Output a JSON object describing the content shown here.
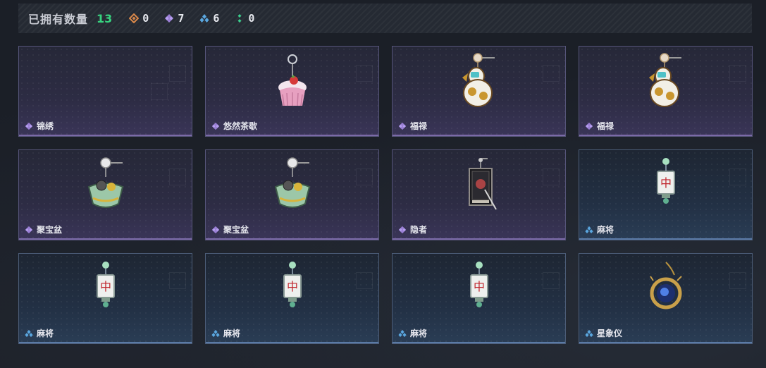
{
  "header": {
    "owned_label": "已拥有数量",
    "owned_count": "13",
    "rarities": [
      {
        "icon": "orange-gem-icon",
        "color": "#d9884a",
        "count": "0"
      },
      {
        "icon": "purple-gem-icon",
        "color": "#9b7fd6",
        "count": "7"
      },
      {
        "icon": "blue-gem-icon",
        "color": "#5aa7e0",
        "count": "6"
      },
      {
        "icon": "green-gem-icon",
        "color": "#3ccf8e",
        "count": "0"
      }
    ]
  },
  "items": [
    {
      "name": "锦绣",
      "rarity": "purple",
      "icon": "empty"
    },
    {
      "name": "悠然茶歇",
      "rarity": "purple",
      "icon": "cupcake-charm-icon"
    },
    {
      "name": "福禄",
      "rarity": "purple",
      "icon": "gourd-charm-icon"
    },
    {
      "name": "福禄",
      "rarity": "purple",
      "icon": "gourd-charm-icon"
    },
    {
      "name": "聚宝盆",
      "rarity": "purple",
      "icon": "treasure-bowl-charm-icon"
    },
    {
      "name": "聚宝盆",
      "rarity": "purple",
      "icon": "treasure-bowl-charm-icon"
    },
    {
      "name": "隐者",
      "rarity": "purple",
      "icon": "tarot-card-charm-icon"
    },
    {
      "name": "麻将",
      "rarity": "blue",
      "icon": "mahjong-tile-charm-icon"
    },
    {
      "name": "麻将",
      "rarity": "blue",
      "icon": "mahjong-tile-charm-icon"
    },
    {
      "name": "麻将",
      "rarity": "blue",
      "icon": "mahjong-tile-charm-icon"
    },
    {
      "name": "麻将",
      "rarity": "blue",
      "icon": "mahjong-tile-charm-icon"
    },
    {
      "name": "星象仪",
      "rarity": "blue",
      "icon": "astrolabe-charm-icon"
    }
  ],
  "mahjong_glyph": "中",
  "colors": {
    "purple": "#9b7fd6",
    "blue": "#5aa7e0",
    "count_green": "#37d27f"
  }
}
